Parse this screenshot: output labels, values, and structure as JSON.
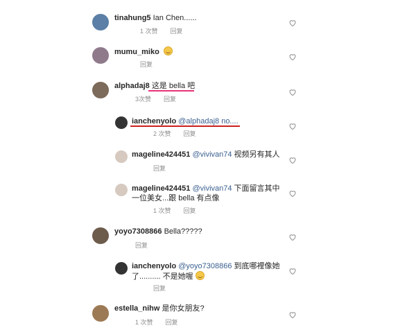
{
  "comments": [
    {
      "user": "tinahung5",
      "text": "Ian Chen......",
      "likes": "1 次赞",
      "reply": "回复",
      "avatar_color": "#5b7fa6"
    },
    {
      "user": "mumu_miko",
      "text": "",
      "reply": "回复",
      "avatar_color": "#8f7a8c"
    },
    {
      "user": "alphadaj8",
      "text_pre": "这是 ",
      "text_mid": "bella",
      "text_post": " 吧",
      "likes": "3次赞",
      "reply": "回复",
      "underline_color": "#e8317c",
      "avatar_color": "#7c6a5a"
    },
    {
      "user": "ianchenyolo",
      "mention": "@alphadaj8",
      "text": " no....",
      "likes": "2 次赞",
      "reply": "回复",
      "underline_color": "#cc1f1f",
      "avatar_color": "#333333"
    },
    {
      "user": "mageline424451",
      "mention": "@vivivan74",
      "text": " 视频另有其人",
      "reply": "回复",
      "avatar_color": "#d6c9c0"
    },
    {
      "user": "mageline424451",
      "mention": "@vivivan74",
      "text": " 下面留言其中",
      "text_line2": "一位美女...跟 bella 有点像",
      "likes": "1 次赞",
      "reply": "回复",
      "avatar_color": "#d6c9c0"
    },
    {
      "user": "yoyo7308866",
      "text": "Bella?????",
      "reply": "回复",
      "avatar_color": "#6d5b4c"
    },
    {
      "user": "ianchenyolo",
      "mention": "@yoyo7308866",
      "text": " 到底哪裡像她",
      "text_line2": "了.......... 不是她喔",
      "reply": "回复",
      "avatar_color": "#333333"
    },
    {
      "user": "estella_nihw",
      "text": "是你女朋友?",
      "likes": "1 次赞",
      "reply": "回复",
      "avatar_color": "#9c7a55"
    }
  ],
  "icons": {
    "like": "heart-icon",
    "emoji": "smiley-emoji-icon"
  }
}
